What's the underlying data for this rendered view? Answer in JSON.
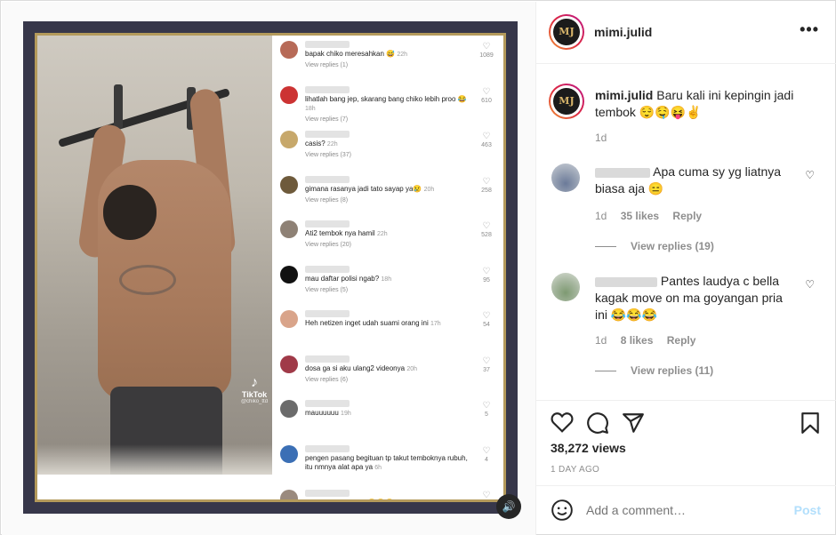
{
  "post": {
    "username": "mimi.julid",
    "avatar_text": "MJ",
    "caption_username": "mimi.julid",
    "caption_text": "Baru kali ini kepingin jadi tembok 😌🤤😝✌",
    "caption_age": "1d",
    "views": "38,272 views",
    "posted": "1 DAY AGO",
    "add_comment_placeholder": "Add a comment…",
    "post_label": "Post"
  },
  "comments": [
    {
      "text": "Apa cuma sy yg liatnya biasa aja 😑",
      "age": "1d",
      "likes": "35 likes",
      "reply": "Reply",
      "view_replies": "View replies (19)"
    },
    {
      "text": "Pantes laudya c bella kagak move on ma goyangan pria ini 😂😂😂",
      "age": "1d",
      "likes": "8 likes",
      "reply": "Reply",
      "view_replies": "View replies (11)"
    }
  ],
  "tiktok": {
    "brand": "TikTok",
    "handle": "@chiko_ttd",
    "comments": [
      {
        "text": "bapak chiko meresahkan 😅",
        "time": "22h",
        "replies": "View replies (1)",
        "likes": "1089",
        "color": "#b76a57"
      },
      {
        "text": "lihatlah bang jep, skarang bang chiko lebih proo 😂",
        "time": "18h",
        "replies": "View replies (7)",
        "likes": "610",
        "color": "#c33"
      },
      {
        "text": "casis?",
        "time": "22h",
        "replies": "View replies (37)",
        "likes": "463",
        "color": "#c7a86b"
      },
      {
        "text": "gimana rasanya jadi tato sayap ya😢",
        "time": "20h",
        "replies": "View replies (8)",
        "likes": "258",
        "color": "#6e5a3b"
      },
      {
        "text": "Ati2 tembok nya hamil",
        "time": "22h",
        "replies": "View replies (20)",
        "likes": "528",
        "color": "#8e8175"
      },
      {
        "text": "mau daftar polisi ngab?",
        "time": "18h",
        "replies": "View replies (5)",
        "likes": "95",
        "color": "#111"
      },
      {
        "text": "Heh netizen inget udah suami orang ini",
        "time": "17h",
        "replies": "",
        "likes": "54",
        "color": "#d9a48a"
      },
      {
        "text": "dosa ga si aku ulang2 videonya",
        "time": "20h",
        "replies": "View replies (6)",
        "likes": "37",
        "color": "#a03a48"
      },
      {
        "text": "mauuuuuu",
        "time": "19h",
        "replies": "",
        "likes": "5",
        "color": "#6b6b6b"
      },
      {
        "text": "pengen pasang begituan tp takut temboknya rubuh, itu nmnya alat apa ya",
        "time": "6h",
        "replies": "",
        "likes": "4",
        "color": "#3b6fb5"
      },
      {
        "text": "masyaallah cichooo😂😂😂",
        "time": "22h",
        "replies": "",
        "likes": "19",
        "color": "#9a8a7e"
      }
    ]
  },
  "icons": {
    "more": "more-options-icon",
    "like": "heart-icon",
    "comment": "comment-icon",
    "share": "share-icon",
    "save": "bookmark-icon",
    "emoji": "emoji-icon",
    "sound": "speaker-icon"
  }
}
